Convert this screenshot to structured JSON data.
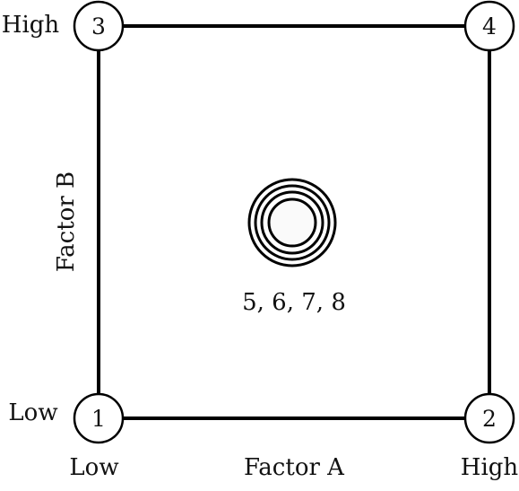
{
  "diagram": {
    "type": "factorial-design-square",
    "line_color": "#000000",
    "center_fill": "#fafafa",
    "axes": {
      "x": {
        "label": "Factor A",
        "low": "Low",
        "high": "High"
      },
      "y": {
        "label": "Factor B",
        "low": "Low",
        "high": "High"
      }
    },
    "corners": [
      {
        "id": "1",
        "a": "Low",
        "b": "Low"
      },
      {
        "id": "2",
        "a": "High",
        "b": "Low"
      },
      {
        "id": "3",
        "a": "Low",
        "b": "High"
      },
      {
        "id": "4",
        "a": "High",
        "b": "High"
      }
    ],
    "center": {
      "label": "5, 6, 7, 8",
      "runs": [
        "5",
        "6",
        "7",
        "8"
      ]
    }
  }
}
